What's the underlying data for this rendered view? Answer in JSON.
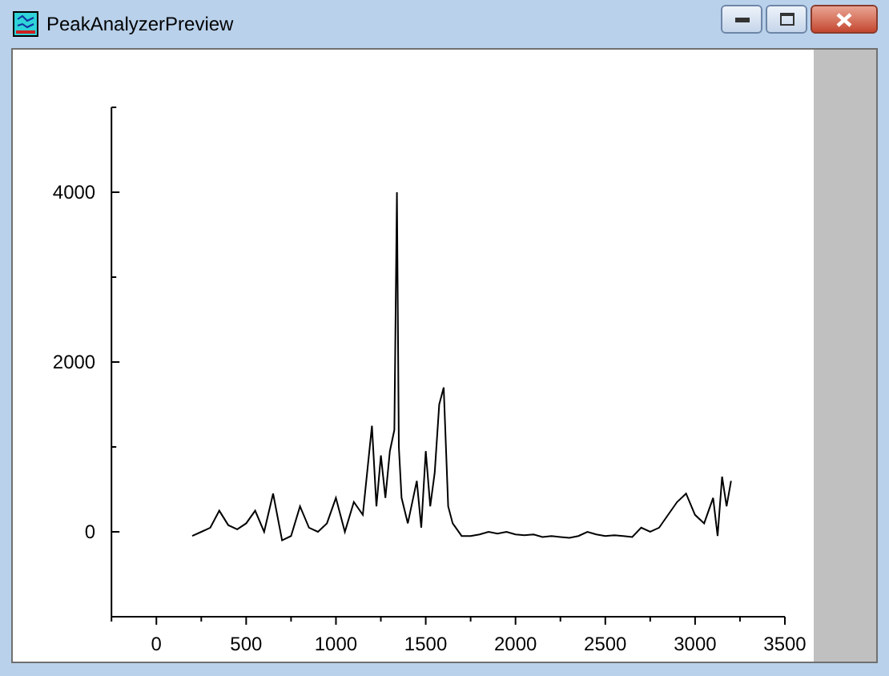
{
  "window": {
    "title": "PeakAnalyzerPreview"
  },
  "plot": {
    "chart_data": {
      "type": "line",
      "xlim": [
        -250,
        3500
      ],
      "ylim": [
        -1000,
        5000
      ],
      "xticks": [
        0,
        500,
        1000,
        1500,
        2000,
        2500,
        3000,
        3500
      ],
      "yticks": [
        0,
        2000,
        4000
      ],
      "x": [
        200,
        250,
        300,
        350,
        400,
        450,
        500,
        550,
        600,
        650,
        700,
        750,
        800,
        850,
        900,
        950,
        1000,
        1050,
        1100,
        1150,
        1200,
        1225,
        1250,
        1275,
        1300,
        1325,
        1340,
        1350,
        1365,
        1400,
        1450,
        1475,
        1500,
        1525,
        1550,
        1575,
        1600,
        1625,
        1650,
        1700,
        1750,
        1800,
        1850,
        1900,
        1950,
        2000,
        2050,
        2100,
        2150,
        2200,
        2250,
        2300,
        2350,
        2400,
        2450,
        2500,
        2550,
        2600,
        2650,
        2700,
        2750,
        2800,
        2850,
        2900,
        2950,
        3000,
        3050,
        3100,
        3125,
        3150,
        3175,
        3200
      ],
      "series": [
        {
          "color": "#000000",
          "values": [
            -50,
            0,
            50,
            250,
            80,
            30,
            100,
            250,
            0,
            450,
            -100,
            -50,
            300,
            50,
            0,
            100,
            400,
            0,
            350,
            200,
            1250,
            300,
            900,
            400,
            950,
            1200,
            4000,
            1000,
            400,
            100,
            600,
            50,
            950,
            300,
            700,
            1500,
            1700,
            300,
            100,
            -50,
            -50,
            -30,
            0,
            -20,
            0,
            -30,
            -40,
            -30,
            -60,
            -50,
            -60,
            -70,
            -50,
            0,
            -30,
            -50,
            -40,
            -50,
            -60,
            50,
            0,
            50,
            200,
            350,
            450,
            200,
            100,
            400,
            -50,
            650,
            300,
            600
          ]
        }
      ]
    }
  },
  "buttons": [
    {
      "kind": "minimize"
    },
    {
      "kind": "maximize"
    },
    {
      "kind": "close"
    }
  ]
}
